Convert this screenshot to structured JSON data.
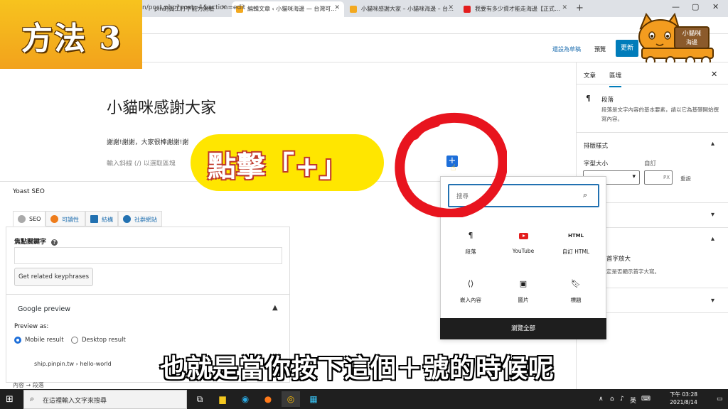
{
  "banner": {
    "text": "方法 3"
  },
  "browser": {
    "tabs": [
      {
        "label": "pin的員工打字能力測驗"
      },
      {
        "label": "編輯文章 ‹ 小貓咪海邊 — 台灣可…"
      },
      {
        "label": "小貓咪感謝大家 – 小貓咪海邊 – 台…"
      },
      {
        "label": "我要有多少資才能走海邊【正式…"
      }
    ],
    "new_tab": "+",
    "address": "n/post.php?post=1&action=edit"
  },
  "wp_toolbar": {
    "save_draft": "還設為草稿",
    "preview": "預覽",
    "update": "更新"
  },
  "cat_logo": {
    "line1": "小貓咪",
    "line2": "海邊"
  },
  "editor": {
    "title": "小貓咪感謝大家",
    "paragraph": "謝謝!謝謝，大家很棒謝謝!謝",
    "placeholder": "輸入斜線 (/) 以選取區塊"
  },
  "callout": {
    "text": "點擊「+」"
  },
  "inserter": {
    "search_placeholder": "搜尋",
    "blocks": [
      {
        "icon": "¶",
        "label": "段落"
      },
      {
        "icon": "youtube",
        "label": "YouTube"
      },
      {
        "icon": "HTML",
        "label": "自訂 HTML"
      },
      {
        "icon": "‹›",
        "label": "嵌入內容"
      },
      {
        "icon": "image",
        "label": "圖片"
      },
      {
        "icon": "bookmark",
        "label": "標題"
      }
    ],
    "browse_all": "瀏覽全部"
  },
  "yoast": {
    "title": "Yoast SEO",
    "tabs": [
      "SEO",
      "可讀性",
      "結構",
      "社群網站"
    ],
    "focus_label": "焦點關鍵字",
    "related_button": "Get related keyphrases",
    "google_preview": "Google preview",
    "preview_as": "Preview as:",
    "mobile": "Mobile result",
    "desktop": "Desktop result",
    "snippet_url": "ship.pinpin.tw › hello-world"
  },
  "sidebar": {
    "tab_post": "文章",
    "tab_block": "區塊",
    "block_name": "段落",
    "block_desc": "段落是文字內容的基本要素，請以它為基礎開始撰寫內容。",
    "typography": "排版樣式",
    "font_size": "字型大小",
    "custom": "自訂",
    "px": "PX",
    "reset": "重設",
    "dropcap": "首字放大",
    "dropcap_desc": "定是否顯示首字大寫。"
  },
  "subtitle": "也就是當你按下這個＋號的時候呢",
  "breadcrumb": "內容 → 段落",
  "taskbar": {
    "search_placeholder": "在這裡輸入文字來搜尋",
    "ime": "英",
    "time": "下午 03:28",
    "date": "2021/8/14"
  },
  "colors": {
    "accent": "#007cba",
    "banner": "#f2a21c",
    "callout": "#ffe600",
    "circle": "#e8141e"
  }
}
